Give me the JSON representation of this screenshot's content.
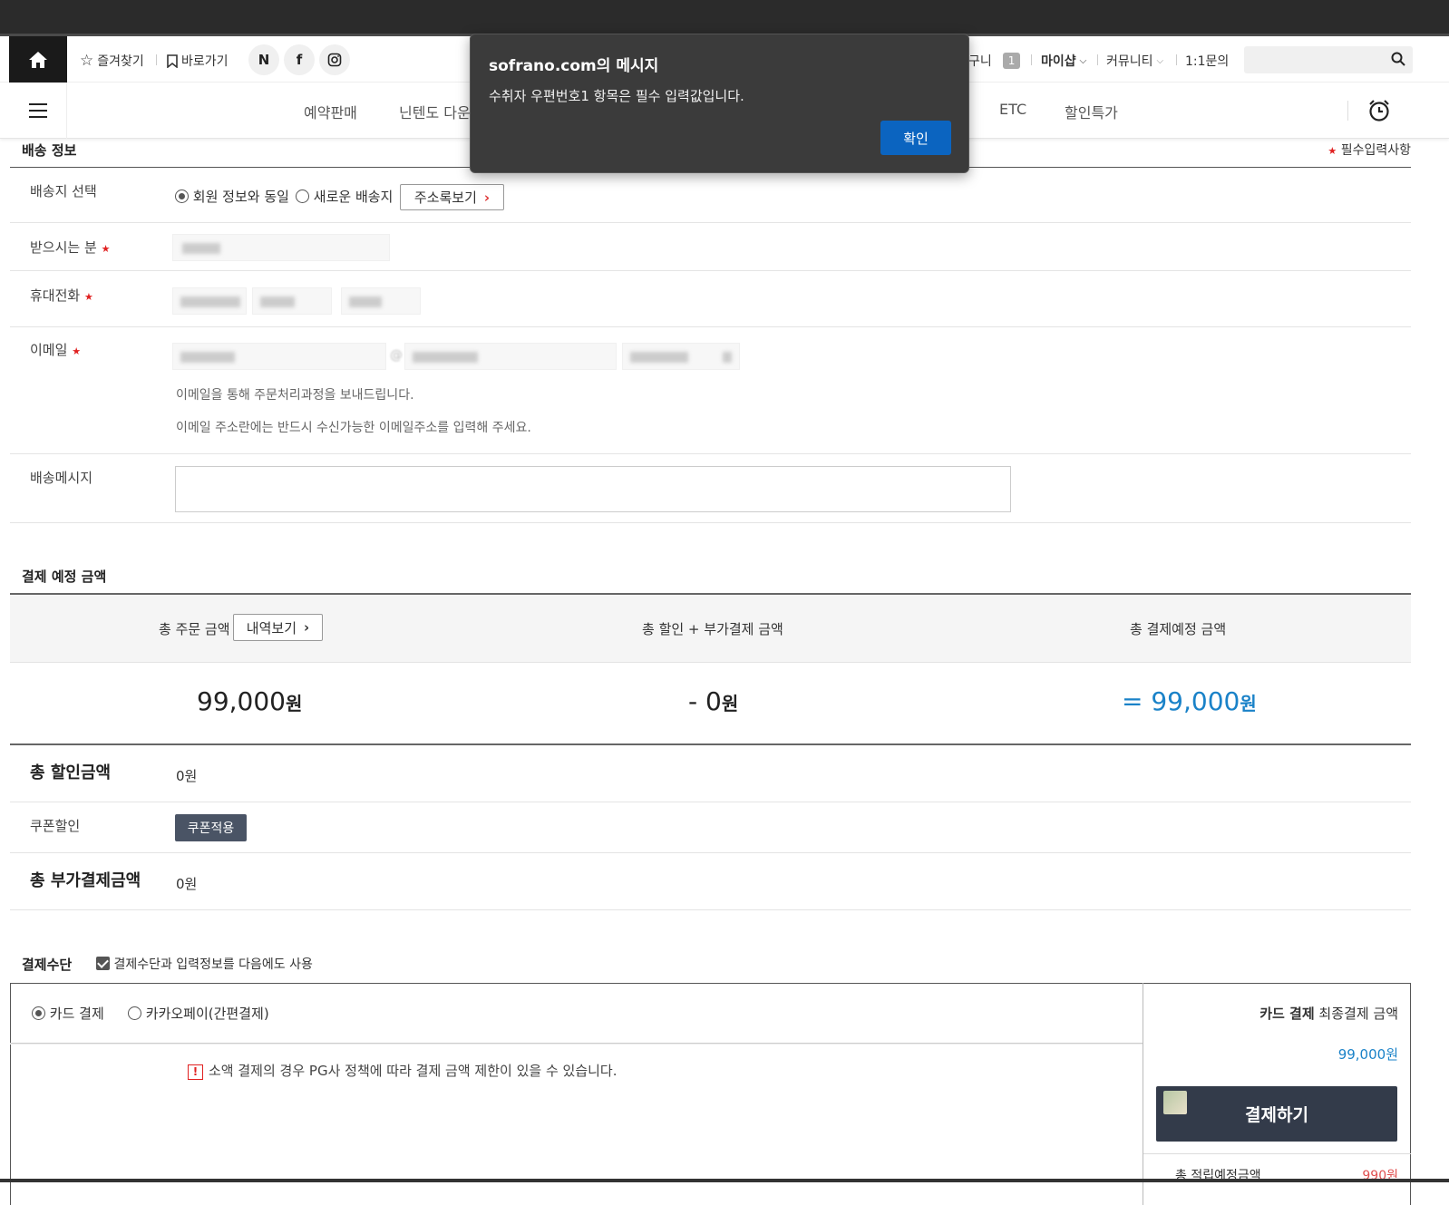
{
  "topbar": {
    "favorites": "즐겨찾기",
    "shortcut": "바로가기",
    "sns": [
      "N",
      "f",
      "insta"
    ],
    "cart_label": "장바구니",
    "cart_visible": "구니",
    "cart_count": "1",
    "myshop": "마이샵",
    "community": "커뮤니티",
    "inquiry": "1:1문의"
  },
  "nav": {
    "items": [
      "예약판매",
      "닌텐도 다운",
      "ETC",
      "할인특가"
    ]
  },
  "dialog": {
    "title": "sofrano.com의 메시지",
    "message": "수취자 우편번호1 항목은 필수 입력값입니다.",
    "ok": "확인"
  },
  "shipping": {
    "title": "배송 정보",
    "required_note": "필수입력사항",
    "select_label": "배송지 선택",
    "option_same": "회원 정보와 동일",
    "option_new": "새로운 배송지",
    "address_book": "주소록보기",
    "recipient_label": "받으시는 분",
    "phone_label": "휴대전화",
    "email_label": "이메일",
    "email_at": "@",
    "email_help1": "이메일을 통해 주문처리과정을 보내드립니다.",
    "email_help2": "이메일 주소란에는 반드시 수신가능한 이메일주소를 입력해 주세요.",
    "message_label": "배송메시지"
  },
  "payment_summary": {
    "title": "결제 예정 금액",
    "total_order_label": "총 주문 금액",
    "detail_btn": "내역보기",
    "discount_label": "총 할인 + 부가결제 금액",
    "expected_label": "총 결제예정 금액",
    "total_order_amount": "99,000",
    "discount_amount": "- 0",
    "expected_amount": "= 99,000",
    "currency": "원",
    "total_discount_label": "총 할인금액",
    "total_discount_value": "0원",
    "coupon_label": "쿠폰할인",
    "coupon_btn": "쿠폰적용",
    "total_extra_label": "총 부가결제금액",
    "total_extra_value": "0원"
  },
  "payment_method": {
    "title": "결제수단",
    "reuse_label": "결제수단과 입력정보를 다음에도 사용",
    "card": "카드 결제",
    "kakao": "카카오페이(간편결제)",
    "notice": "소액 결제의 경우 PG사 정책에 따라 결제 금액 제한이 있을 수 있습니다.",
    "right_title_strong": "카드 결제",
    "right_title_rest": "최종결제 금액",
    "final_amount": "99,000",
    "final_currency": "원",
    "pay_btn": "결제하기",
    "points_label": "총 적립예정금액",
    "points_value": "990원"
  },
  "colors": {
    "accent_blue": "#1a82c8",
    "dialog_button": "#0b64c0",
    "required_red": "#e02020",
    "dark_button": "#333b4a"
  }
}
